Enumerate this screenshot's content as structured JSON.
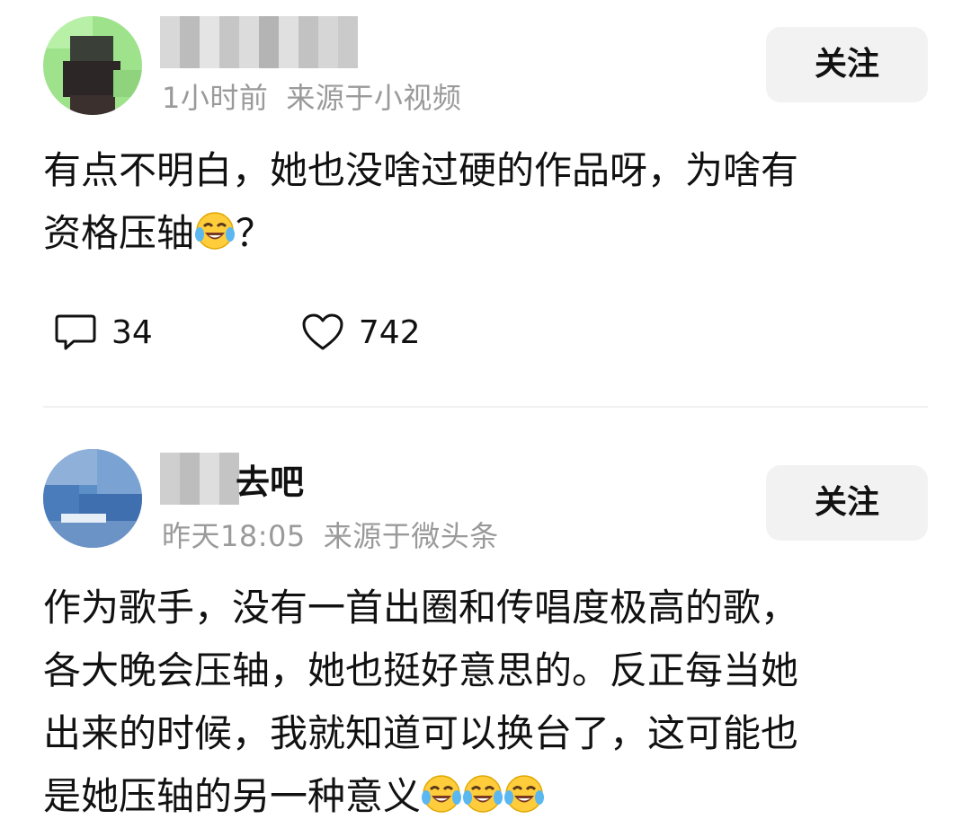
{
  "comments": [
    {
      "time": "1小时前",
      "source": "来源于小视频",
      "follow_label": "关注",
      "text": "有点不明白，她也没啥过硬的作品呀，为啥有\n资格压轴",
      "text_tail": "？",
      "trailing_emoji_count": 1,
      "reply_count": "34",
      "like_count": "742",
      "reply_icon": "comment-bubble-icon",
      "like_icon": "heart-outline-icon"
    },
    {
      "name_visible": "去吧",
      "time": "昨天18:05",
      "source": "来源于微头条",
      "follow_label": "关注",
      "text": "作为歌手，没有一首出圈和传唱度极高的歌，\n各大晚会压轴，她也挺好意思的。反正每当她\n出来的时候，我就知道可以换台了，这可能也\n是她压轴的另一种意义",
      "trailing_emoji_count": 3
    }
  ],
  "colors": {
    "text": "#111111",
    "meta": "#9a9a9a",
    "button_bg": "#f2f2f2"
  }
}
